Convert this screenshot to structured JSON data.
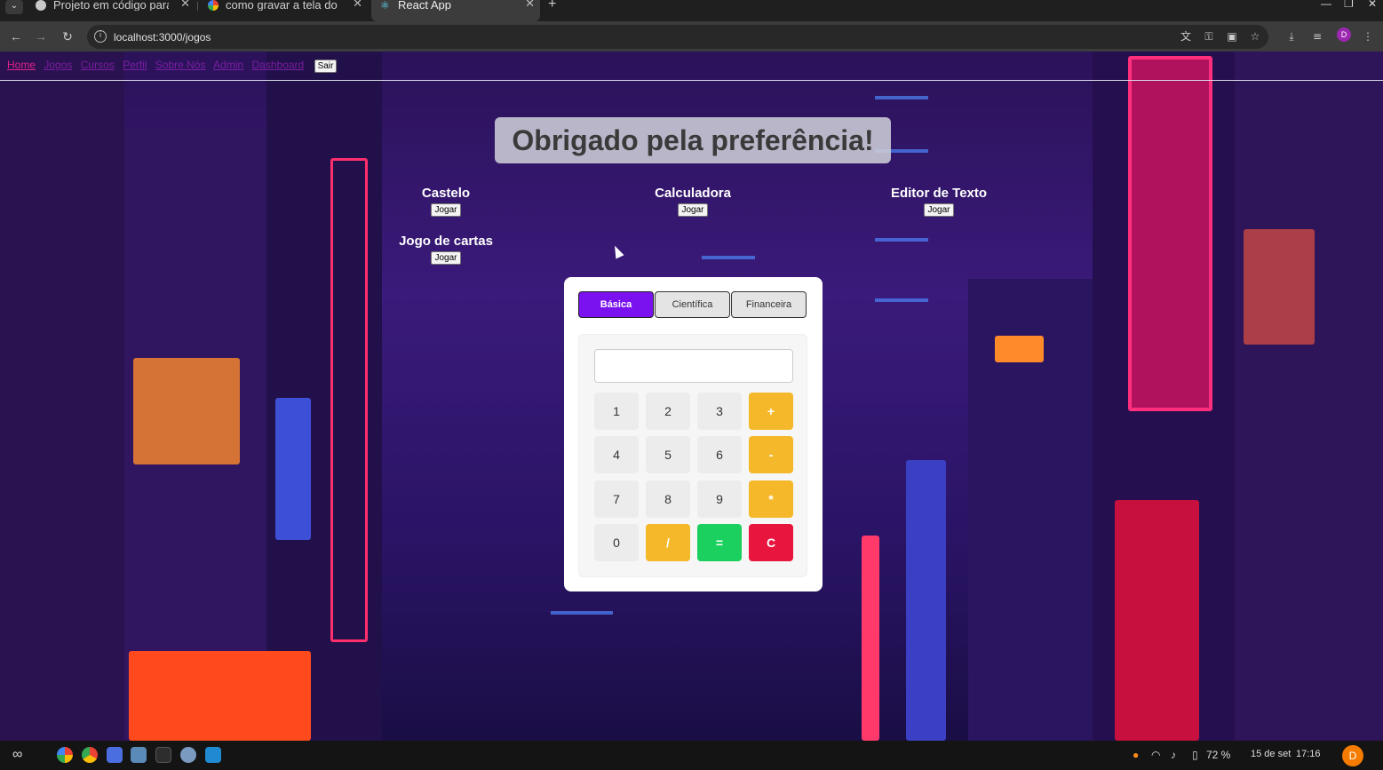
{
  "browser": {
    "tabs": [
      {
        "title": "Projeto em código para",
        "active": false
      },
      {
        "title": "como gravar a tela do p",
        "active": false
      },
      {
        "title": "React App",
        "active": true
      }
    ],
    "url": "localhost:3000/jogos",
    "profile_initial": "D"
  },
  "app": {
    "nav": {
      "links": [
        "Home",
        "Jogos",
        "Cursos",
        "Perfil",
        "Sobre Nós",
        "Admin",
        "Dashboard"
      ],
      "logout_label": "Sair"
    },
    "heading": "Obrigado pela preferência!",
    "play_label": "Jogar",
    "games": [
      {
        "name": "Castelo"
      },
      {
        "name": "Calculadora"
      },
      {
        "name": "Editor de Texto"
      },
      {
        "name": "Jogo de cartas"
      }
    ],
    "calculator": {
      "tabs": [
        "Básica",
        "Científica",
        "Financeira"
      ],
      "active_tab": "Básica",
      "display_value": "",
      "keys": [
        "1",
        "2",
        "3",
        "+",
        "4",
        "5",
        "6",
        "-",
        "7",
        "8",
        "9",
        "*",
        "0",
        "/",
        "=",
        "C"
      ],
      "colors": {
        "accent": "#7a12f0",
        "operator": "#f5b82a",
        "equals": "#1bd05e",
        "clear": "#e8163e"
      }
    }
  },
  "taskbar": {
    "battery": "72 %",
    "date": "15 de set",
    "time": "17:16",
    "user_initial": "D"
  }
}
